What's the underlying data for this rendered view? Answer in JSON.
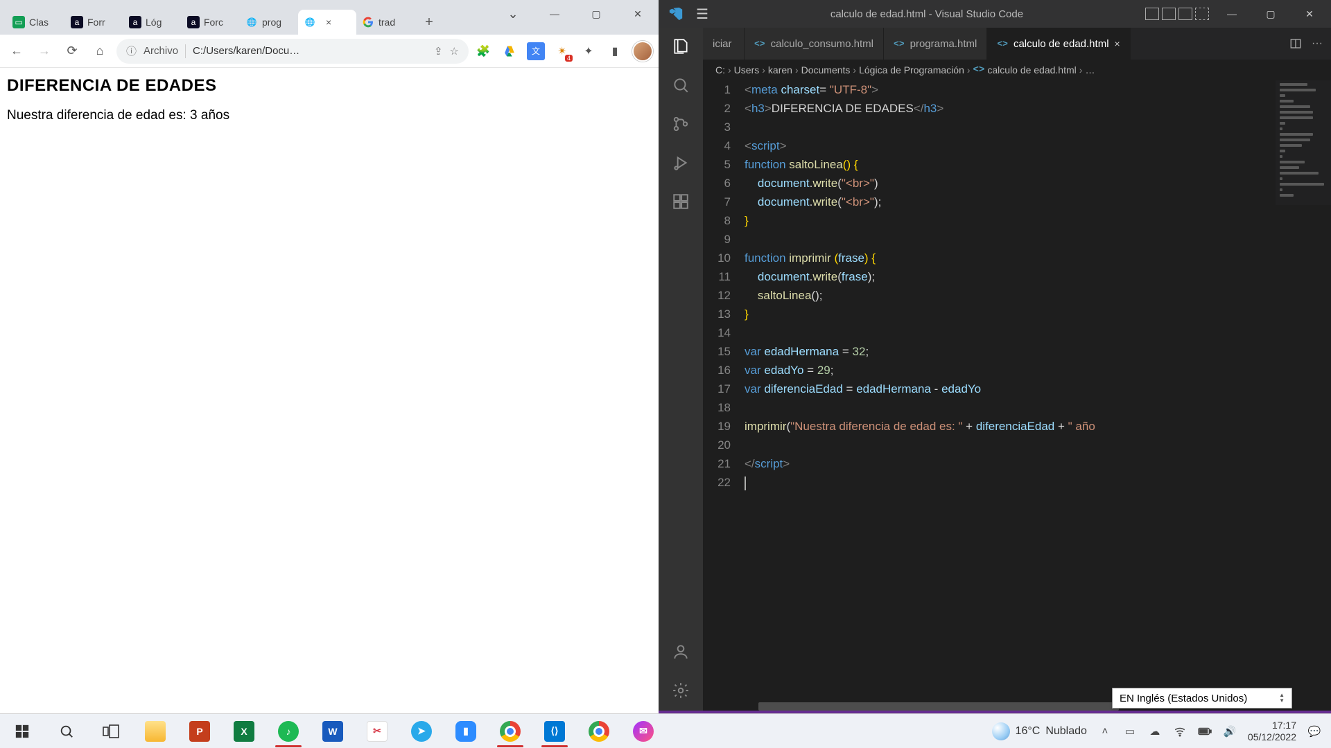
{
  "chrome": {
    "tabs": [
      {
        "label": "Clas"
      },
      {
        "label": "Forr"
      },
      {
        "label": "Lóg"
      },
      {
        "label": "Forc"
      },
      {
        "label": "prog"
      },
      {
        "label": ""
      },
      {
        "label": "trad"
      }
    ],
    "active_tab_index": 5,
    "url_prefix": "Archivo",
    "url_path": "C:/Users/karen/Docu…",
    "page": {
      "heading": "DIFERENCIA DE EDADES",
      "body": "Nuestra diferencia de edad es: 3 años"
    }
  },
  "vscode": {
    "title": "calculo de edad.html - Visual Studio Code",
    "tabs": [
      {
        "label": "iciar",
        "truncated": true
      },
      {
        "label": "calculo_consumo.html"
      },
      {
        "label": "programa.html"
      },
      {
        "label": "calculo de edad.html",
        "active": true
      }
    ],
    "breadcrumb": [
      "C:",
      "Users",
      "karen",
      "Documents",
      "Lógica de Programación",
      "calculo de edad.html",
      "…"
    ],
    "code_lines": [
      {
        "n": 1,
        "html": "<span class='tk-tag'>&lt;</span><span class='tk-name'>meta</span> <span class='tk-attr'>charset</span><span class='tk-op'>=</span> <span class='tk-str'>\"UTF-8\"</span><span class='tk-tag'>&gt;</span>"
      },
      {
        "n": 2,
        "html": "<span class='tk-tag'>&lt;</span><span class='tk-name'>h3</span><span class='tk-tag'>&gt;</span><span class='tk-txt'>DIFERENCIA DE EDADES</span><span class='tk-tag'>&lt;/</span><span class='tk-name'>h3</span><span class='tk-tag'>&gt;</span>"
      },
      {
        "n": 3,
        "html": ""
      },
      {
        "n": 4,
        "html": "<span class='tk-tag'>&lt;</span><span class='tk-name'>script</span><span class='tk-tag'>&gt;</span>"
      },
      {
        "n": 5,
        "html": "<span class='tk-kw'>function</span> <span class='tk-fn'>saltoLinea</span><span class='tk-br'>()</span> <span class='tk-br'>{</span>"
      },
      {
        "n": 6,
        "html": "    <span class='tk-var'>document</span>.<span class='tk-fn'>write</span>(<span class='tk-str'>\"&lt;br&gt;\"</span>)"
      },
      {
        "n": 7,
        "html": "    <span class='tk-var'>document</span>.<span class='tk-fn'>write</span>(<span class='tk-str'>\"&lt;br&gt;\"</span>);"
      },
      {
        "n": 8,
        "html": "<span class='tk-br'>}</span>"
      },
      {
        "n": 9,
        "html": ""
      },
      {
        "n": 10,
        "html": "<span class='tk-kw'>function</span> <span class='tk-fn'>imprimir</span> <span class='tk-br'>(</span><span class='tk-var'>frase</span><span class='tk-br'>)</span> <span class='tk-br'>{</span>"
      },
      {
        "n": 11,
        "html": "    <span class='tk-var'>document</span>.<span class='tk-fn'>write</span>(<span class='tk-var'>frase</span>);"
      },
      {
        "n": 12,
        "html": "    <span class='tk-fn'>saltoLinea</span>();"
      },
      {
        "n": 13,
        "html": "<span class='tk-br'>}</span>"
      },
      {
        "n": 14,
        "html": ""
      },
      {
        "n": 15,
        "html": "<span class='tk-kw'>var</span> <span class='tk-var'>edadHermana</span> <span class='tk-op'>=</span> <span class='tk-num'>32</span>;"
      },
      {
        "n": 16,
        "html": "<span class='tk-kw'>var</span> <span class='tk-var'>edadYo</span> <span class='tk-op'>=</span> <span class='tk-num'>29</span>;"
      },
      {
        "n": 17,
        "html": "<span class='tk-kw'>var</span> <span class='tk-var'>diferenciaEdad</span> <span class='tk-op'>=</span> <span class='tk-var'>edadHermana</span> <span class='tk-op'>-</span> <span class='tk-var'>edadYo</span>"
      },
      {
        "n": 18,
        "html": ""
      },
      {
        "n": 19,
        "html": "<span class='tk-fn'>imprimir</span>(<span class='tk-str'>\"Nuestra diferencia de edad es: \"</span> <span class='tk-op'>+</span> <span class='tk-var'>diferenciaEdad</span> <span class='tk-op'>+</span> <span class='tk-str'>\" año</span>"
      },
      {
        "n": 20,
        "html": ""
      },
      {
        "n": 21,
        "html": "<span class='tk-tag'>&lt;/</span><span class='tk-name'>script</span><span class='tk-tag'>&gt;</span>"
      },
      {
        "n": 22,
        "html": "<span class='cursor'></span>"
      }
    ]
  },
  "langbar": {
    "label": "EN Inglés (Estados Unidos)"
  },
  "taskbar": {
    "weather_temp": "16°C",
    "weather_label": "Nublado",
    "time": "17:17",
    "date": "05/12/2022"
  }
}
